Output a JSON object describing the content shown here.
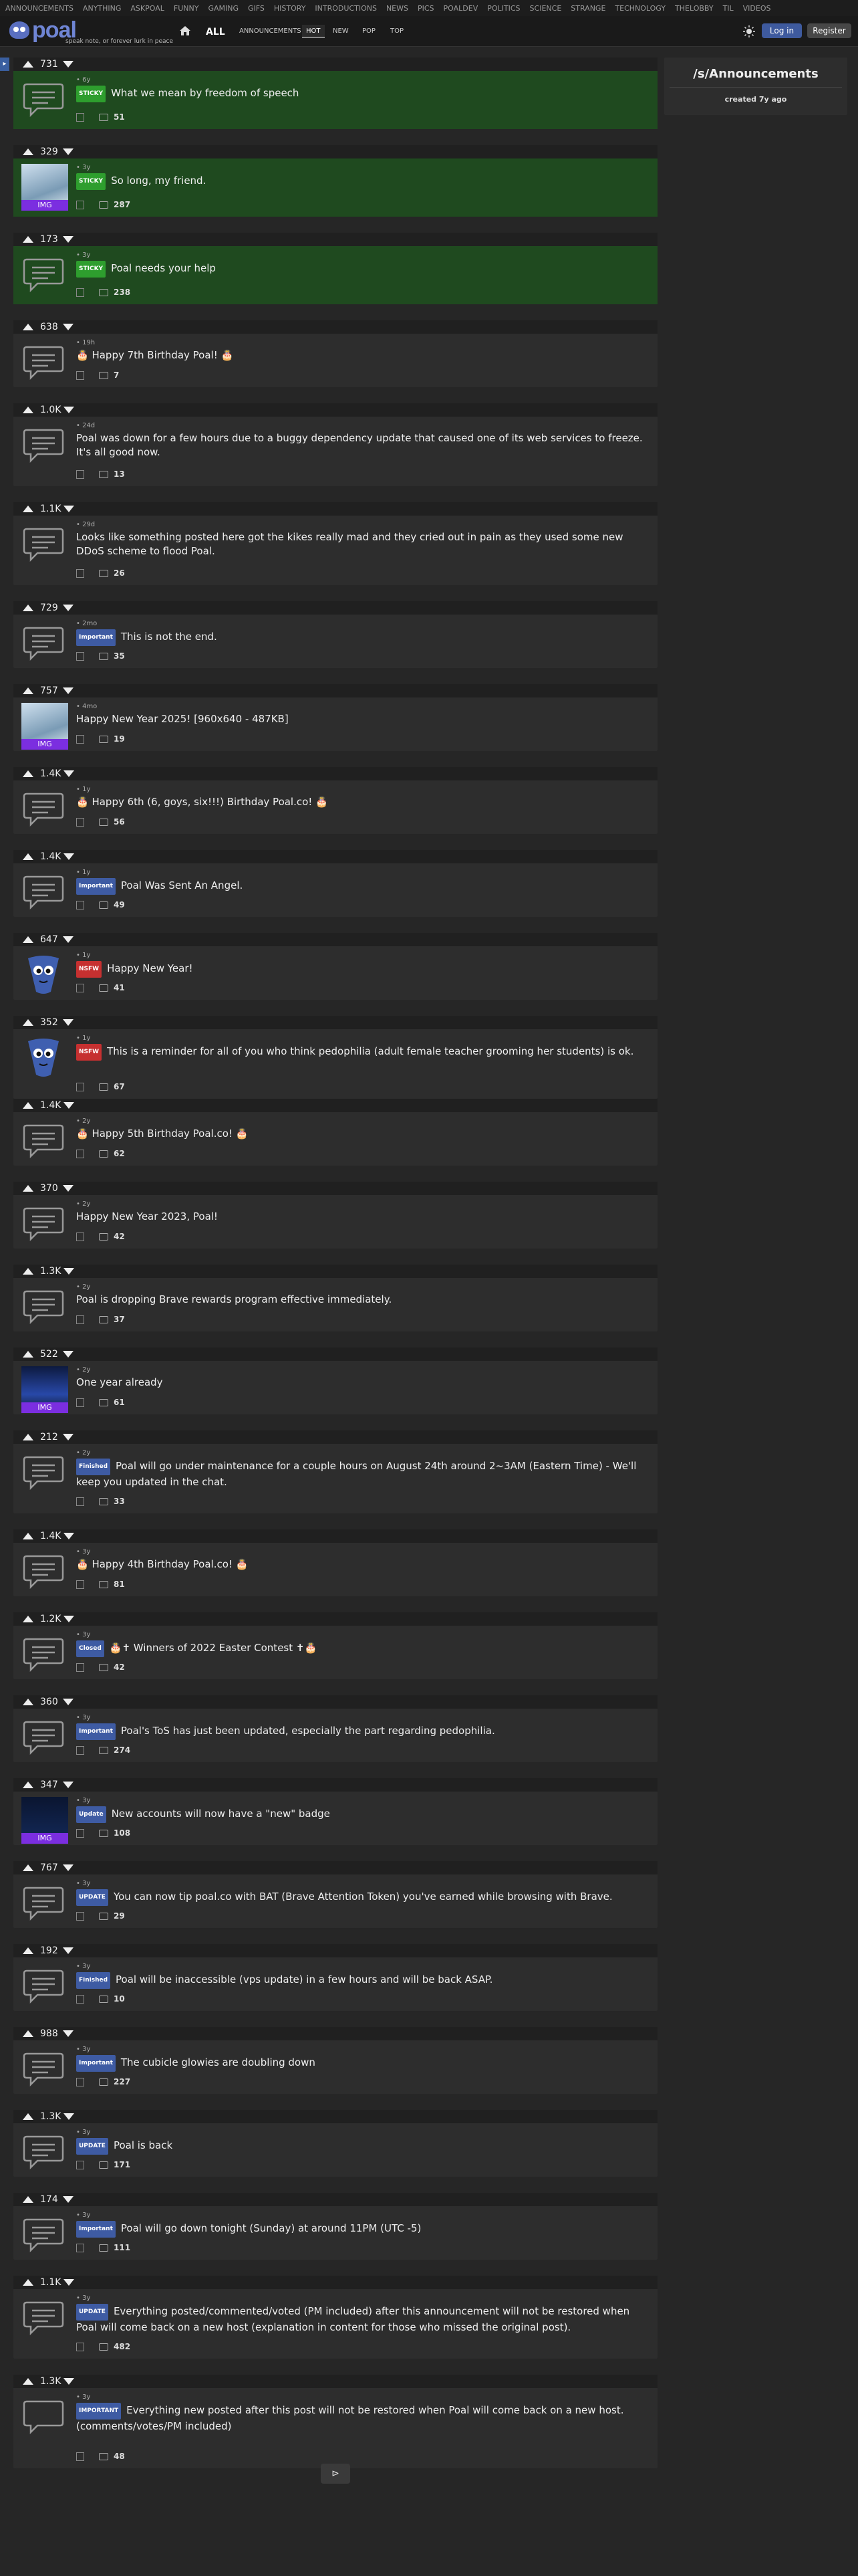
{
  "topnav": [
    "ANNOUNCEMENTS",
    "ANYTHING",
    "ASKPOAL",
    "FUNNY",
    "GAMING",
    "GIFS",
    "HISTORY",
    "INTRODUCTIONS",
    "NEWS",
    "PICS",
    "POALDEV",
    "POLITICS",
    "SCIENCE",
    "STRANGE",
    "TECHNOLOGY",
    "THELOBBY",
    "TIL",
    "VIDEOS"
  ],
  "header": {
    "logo": "poal",
    "tagline": "speak note, or forever lurk in peace",
    "all": "ALL",
    "tabs": [
      "ANNOUNCEMENTS",
      "HOT",
      "NEW",
      "POP",
      "TOP"
    ],
    "selected_tab": "HOT",
    "login": "Log in",
    "register": "Register"
  },
  "sidebar": {
    "name": "/s/Announcements",
    "created": "created 7y ago"
  },
  "icons": {
    "upvote": "arrow-up-icon",
    "downvote": "arrow-down-icon",
    "comment": "comment-icon",
    "home": "home-icon",
    "theme": "sun-icon",
    "next": "next-arrow-icon",
    "thumb": "speech-bubble-icon"
  },
  "posts": [
    {
      "score": "731",
      "age": "6y",
      "flair": "STICKY",
      "flair_type": "sticky",
      "title": "What we mean by freedom of speech",
      "comments": "51",
      "thumb": "text",
      "sticky": true
    },
    {
      "score": "329",
      "age": "3y",
      "flair": "STICKY",
      "flair_type": "sticky",
      "title": "So long, my friend.",
      "comments": "287",
      "thumb": "img",
      "sticky": true
    },
    {
      "score": "173",
      "age": "3y",
      "flair": "STICKY",
      "flair_type": "sticky",
      "title": "Poal needs your help",
      "comments": "238",
      "thumb": "text",
      "sticky": true
    },
    {
      "score": "638",
      "age": "19h",
      "flair": "",
      "flair_type": "",
      "title": "🎂 Happy 7th Birthday Poal! 🎂",
      "comments": "7",
      "thumb": "text"
    },
    {
      "score": "1.0K",
      "age": "24d",
      "flair": "",
      "flair_type": "",
      "title": "Poal was down for a few hours due to a buggy dependency update that caused one of its web services to freeze. It's all good now.",
      "comments": "13",
      "thumb": "text"
    },
    {
      "score": "1.1K",
      "age": "29d",
      "flair": "",
      "flair_type": "",
      "title": "Looks like something posted here got the kikes really mad and they cried out in pain as they used some new DDoS scheme to flood Poal.",
      "comments": "26",
      "thumb": "text"
    },
    {
      "score": "729",
      "age": "2mo",
      "flair": "Important",
      "flair_type": "important",
      "title": "This is not the end.",
      "comments": "35",
      "thumb": "text"
    },
    {
      "score": "757",
      "age": "4mo",
      "flair": "",
      "flair_type": "",
      "title": "Happy New Year 2025! [960x640 - 487KB]",
      "comments": "19",
      "thumb": "img"
    },
    {
      "score": "1.4K",
      "age": "1y",
      "flair": "",
      "flair_type": "",
      "title": "🎂 Happy 6th (6, goys, six!!!) Birthday Poal.co! 🎂",
      "comments": "56",
      "thumb": "text"
    },
    {
      "score": "1.4K",
      "age": "1y",
      "flair": "Important",
      "flair_type": "important",
      "title": "Poal Was Sent An Angel.",
      "comments": "49",
      "thumb": "text"
    },
    {
      "score": "647",
      "age": "1y",
      "flair": "NSFW",
      "flair_type": "nsfw",
      "title": "Happy New Year!",
      "comments": "41",
      "thumb": "mascot"
    },
    {
      "score": "352",
      "age": "1y",
      "flair": "NSFW",
      "flair_type": "nsfw",
      "title": "This is a reminder for all of you who think pedophilia (adult female teacher grooming her students) is ok.",
      "comments": "67",
      "thumb": "mascot"
    },
    {
      "score": "1.4K",
      "age": "2y",
      "flair": "",
      "flair_type": "",
      "title": "🎂 Happy 5th Birthday Poal.co! 🎂",
      "comments": "62",
      "thumb": "text"
    },
    {
      "score": "370",
      "age": "2y",
      "flair": "",
      "flair_type": "",
      "title": "Happy New Year 2023, Poal!",
      "comments": "42",
      "thumb": "text"
    },
    {
      "score": "1.3K",
      "age": "2y",
      "flair": "",
      "flair_type": "",
      "title": "Poal is dropping Brave rewards program effective immediately.",
      "comments": "37",
      "thumb": "text"
    },
    {
      "score": "522",
      "age": "2y",
      "flair": "",
      "flair_type": "",
      "title": "One year already",
      "comments": "61",
      "thumb": "img2"
    },
    {
      "score": "212",
      "age": "2y",
      "flair": "Finished",
      "flair_type": "finished",
      "title": "Poal will go under maintenance for a couple hours on August 24th around 2~3AM (Eastern Time) - We'll keep you updated in the chat.",
      "comments": "33",
      "thumb": "text"
    },
    {
      "score": "1.4K",
      "age": "3y",
      "flair": "",
      "flair_type": "",
      "title": "🎂 Happy 4th Birthday Poal.co! 🎂",
      "comments": "81",
      "thumb": "text"
    },
    {
      "score": "1.2K",
      "age": "3y",
      "flair": "Closed",
      "flair_type": "closed",
      "title": "🎂✝ Winners of 2022 Easter Contest ✝🎂",
      "comments": "42",
      "thumb": "text"
    },
    {
      "score": "360",
      "age": "3y",
      "flair": "Important",
      "flair_type": "important",
      "title": "Poal's ToS has just been updated, especially the part regarding pedophilia.",
      "comments": "274",
      "thumb": "text"
    },
    {
      "score": "347",
      "age": "3y",
      "flair": "Update",
      "flair_type": "update",
      "title": "New accounts will now have a \"new\" badge",
      "comments": "108",
      "thumb": "img3"
    },
    {
      "score": "767",
      "age": "3y",
      "flair": "UPDATE",
      "flair_type": "update",
      "title": "You can now tip poal.co with BAT (Brave Attention Token) you've earned while browsing with Brave.",
      "comments": "29",
      "thumb": "text"
    },
    {
      "score": "192",
      "age": "3y",
      "flair": "Finished",
      "flair_type": "finished",
      "title": "Poal will be inaccessible (vps update) in a few hours and will be back ASAP.",
      "comments": "10",
      "thumb": "text"
    },
    {
      "score": "988",
      "age": "3y",
      "flair": "Important",
      "flair_type": "important",
      "title": "The cubicle glowies are doubling down",
      "comments": "227",
      "thumb": "text"
    },
    {
      "score": "1.3K",
      "age": "3y",
      "flair": "UPDATE",
      "flair_type": "update",
      "title": "Poal is back",
      "comments": "171",
      "thumb": "text"
    },
    {
      "score": "174",
      "age": "3y",
      "flair": "Important",
      "flair_type": "important",
      "title": "Poal will go down tonight (Sunday) at around 11PM (UTC -5)",
      "comments": "111",
      "thumb": "text"
    },
    {
      "score": "1.1K",
      "age": "3y",
      "flair": "UPDATE",
      "flair_type": "update",
      "title": "Everything posted/commented/voted (PM included) after this announcement will not be restored when Poal will come back on a new host (explanation in content for those who missed the original post).",
      "comments": "482",
      "thumb": "text"
    },
    {
      "score": "1.3K",
      "age": "3y",
      "flair": "IMPORTANT",
      "flair_type": "important",
      "title": "Everything new posted after this post will not be restored when Poal will come back on a new host. (comments/votes/PM included)",
      "comments": "48",
      "thumb": "text2"
    }
  ],
  "next_label": "⊳"
}
